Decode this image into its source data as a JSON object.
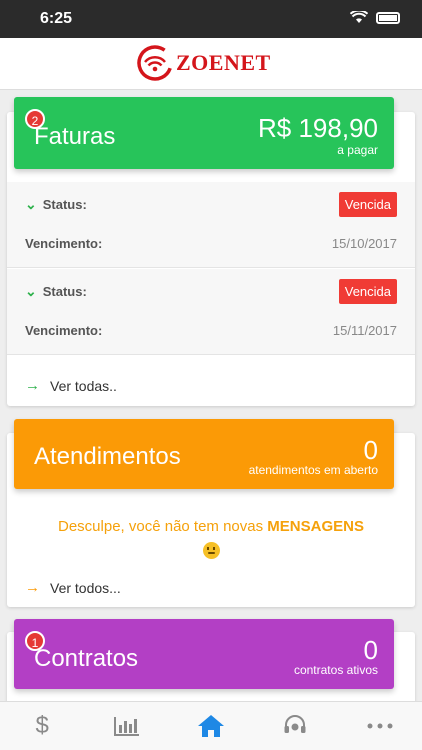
{
  "status_bar": {
    "time": "6:25"
  },
  "header": {
    "brand": "ZOENET"
  },
  "faturas": {
    "badge": "2",
    "title": "Faturas",
    "amount": "R$ 198,90",
    "amount_label": "a pagar",
    "items": [
      {
        "status_label": "Status:",
        "status_value": "Vencida",
        "due_label": "Vencimento:",
        "due_date": "15/10/2017"
      },
      {
        "status_label": "Status:",
        "status_value": "Vencida",
        "due_label": "Vencimento:",
        "due_date": "15/11/2017"
      }
    ],
    "view_all": "Ver todas.."
  },
  "atendimentos": {
    "title": "Atendimentos",
    "count": "0",
    "count_label": "atendimentos em aberto",
    "message_prefix": "Desculpe, você não tem novas",
    "message_highlight": "MENSAGENS",
    "view_all": "Ver todos..."
  },
  "contratos": {
    "badge": "1",
    "title": "Contratos",
    "count": "0",
    "count_label": "contratos ativos"
  },
  "tabs": [
    {
      "name": "dollar-icon",
      "active": false
    },
    {
      "name": "chart-icon",
      "active": false
    },
    {
      "name": "home-icon",
      "active": true
    },
    {
      "name": "support-headset-icon",
      "active": false
    },
    {
      "name": "more-icon",
      "active": false
    }
  ],
  "colors": {
    "faturas": "#27c45a",
    "atendimentos": "#fb9a06",
    "contratos": "#b33fc5",
    "overdue": "#f03b35",
    "active_tab": "#1e88e5",
    "brand": "#d4151b"
  }
}
